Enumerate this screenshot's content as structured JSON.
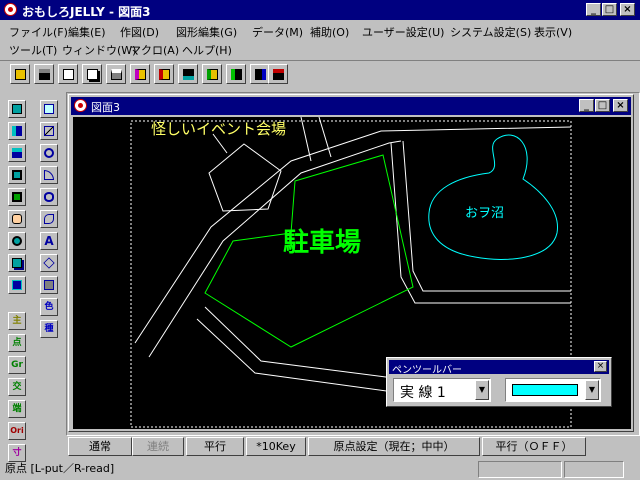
{
  "window": {
    "title": "おもしろJELLY - 図面3",
    "minimize": "_",
    "maximize": "□",
    "close": "×"
  },
  "menu": {
    "row1": [
      "ファイル(F)",
      "編集(E)",
      "作図(D)",
      "図形編集(G)",
      "データ(M)",
      "補助(O)",
      "ユーザー設定(U)",
      "システム設定(S)",
      "表示(V)"
    ],
    "row2": [
      "ツール(T)",
      "ウィンドウ(W)",
      "マクロ(A)",
      "ヘルプ(H)"
    ]
  },
  "toolbar": {
    "icons": [
      "open-folder-icon",
      "save-disk-icon",
      "new-page-icon",
      "copy-page-icon",
      "print-icon",
      "folder-magenta-icon",
      "folder-red-icon",
      "save-as-icon",
      "folder-green-icon",
      "save-copy-icon",
      "save-all-icon",
      "save-close-icon"
    ]
  },
  "left_tools": {
    "col1": [
      "select-icon",
      "split-vertical-icon",
      "split-horizontal-icon",
      "stamp-icon",
      "paste-icon",
      "hand-pan-icon",
      "zoom-icon",
      "layer-icon",
      "grid-view-icon"
    ],
    "col1_lower": [
      "主",
      "点",
      "Gr",
      "交",
      "端",
      "Ori",
      "寸"
    ],
    "col2": [
      "text-point-icon",
      "line-icon",
      "circle-icon",
      "arc-icon",
      "ellipse-icon",
      "curve-icon",
      "letter-a-icon",
      "polygon-icon",
      "erase-icon"
    ],
    "col2_lower": [
      "色",
      "種"
    ]
  },
  "document": {
    "title": "図面3",
    "minimize": "_",
    "maximize": "□",
    "close": "×"
  },
  "map": {
    "label_event": "怪しいイベント会場",
    "label_parking": "駐車場",
    "label_pond": "おヲ沼",
    "colors": {
      "event": "#ffff66",
      "parking": "#00ff00",
      "pond": "#00ffff",
      "road": "#ffffff"
    }
  },
  "pen_palette": {
    "title": "ペンツールバー",
    "close": "×",
    "line_type": "実 線 1",
    "arrow": "▼",
    "color": "#00ffff"
  },
  "bottom_buttons": [
    "通常",
    "連続",
    "平行",
    "*10Key",
    "原点設定（現在；中中）",
    "平行（ＯＦＦ）"
  ],
  "status": {
    "message": "原点 [L-put／R-read]"
  }
}
